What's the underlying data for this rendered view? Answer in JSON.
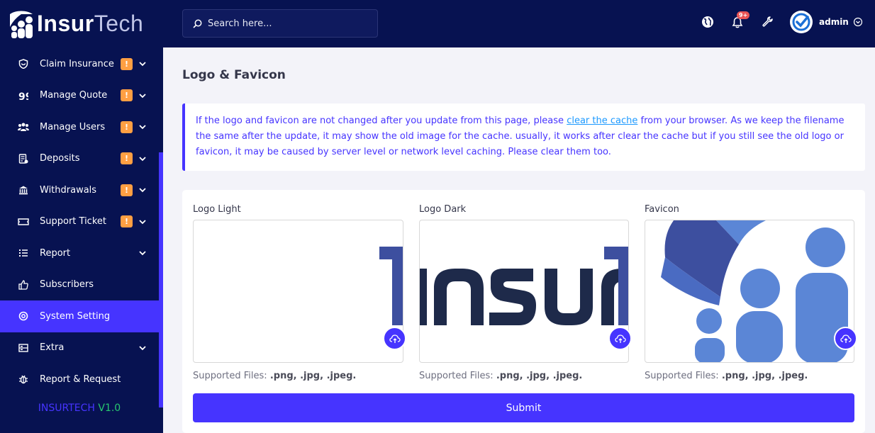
{
  "brand": {
    "name_part1": "Insur",
    "name_part2": "Tech"
  },
  "search": {
    "placeholder": "Search here..."
  },
  "topbar": {
    "notification_count": "9+",
    "user_name": "admin"
  },
  "sidebar": {
    "items": [
      {
        "label": "Claim Insurance",
        "icon": "shield-icon",
        "badge": "!",
        "has_chevron": true
      },
      {
        "label": "Manage Quote",
        "icon": "quote-icon",
        "badge": "!",
        "has_chevron": true
      },
      {
        "label": "Manage Users",
        "icon": "users-icon",
        "badge": "!",
        "has_chevron": true
      },
      {
        "label": "Deposits",
        "icon": "deposit-icon",
        "badge": "!",
        "has_chevron": true
      },
      {
        "label": "Withdrawals",
        "icon": "bank-icon",
        "badge": "!",
        "has_chevron": true
      },
      {
        "label": "Support Ticket",
        "icon": "ticket-icon",
        "badge": "!",
        "has_chevron": true
      },
      {
        "label": "Report",
        "icon": "list-icon",
        "has_chevron": true
      },
      {
        "label": "Subscribers",
        "icon": "thumbs-up-icon"
      },
      {
        "label": "System Setting",
        "icon": "settings-icon",
        "active": true
      },
      {
        "label": "Extra",
        "icon": "server-icon",
        "has_chevron": true
      },
      {
        "label": "Report & Request",
        "icon": "bug-icon"
      }
    ],
    "version_name": "INSURTECH",
    "version_number": "V1.0"
  },
  "page": {
    "title": "Logo & Favicon",
    "alert_before_link": "If the logo and favicon are not changed after you update from this page, please ",
    "alert_link": "clear the cache",
    "alert_after_link": " from your browser. As we keep the filename the same after the update, it may show the old image for the cache. usually, it works after clear the cache but if you still see the old logo or favicon, it may be caused by server level or network level caching. Please clear them too.",
    "uploads": [
      {
        "label": "Logo Light",
        "preview": "logo-light-preview"
      },
      {
        "label": "Logo Dark",
        "preview": "logo-dark-preview"
      },
      {
        "label": "Favicon",
        "preview": "favicon-preview"
      }
    ],
    "supported_prefix": "Supported Files:",
    "supported_types": ".png, .jpg, .jpeg.",
    "submit_label": "Submit"
  },
  "colors": {
    "sidebar_bg": "#071251",
    "accent": "#4634ff",
    "badge": "#ff9f43",
    "version_green": "#28c76f"
  }
}
